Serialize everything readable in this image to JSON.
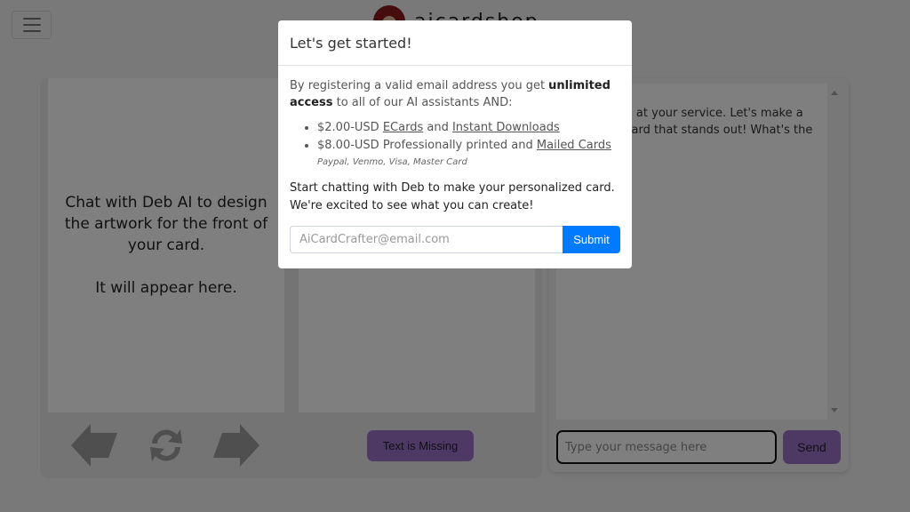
{
  "header": {
    "menu_icon": "hamburger-menu-icon",
    "logo_text": "aicardshop"
  },
  "card": {
    "front_text": "Chat with Deb AI to design the artwork for the front of your card.\n\nIt will appear here.",
    "prev_icon": "arrow-left-icon",
    "refresh_icon": "refresh-icon",
    "next_icon": "arrow-right-icon",
    "text_missing_label": "Text is Missing"
  },
  "chat": {
    "message": "Hey! DebAI at your service. Let's make a greetings card that stands out! What's the occasion?",
    "input_placeholder": "Type your message here",
    "send_label": "Send"
  },
  "modal": {
    "title": "Let's get started!",
    "intro_pre": "By registering a valid email address you get ",
    "intro_bold": "unlimited access",
    "intro_post": " to all of our AI assistants AND:",
    "offers": [
      {
        "price": "$2.00-USD ",
        "link1": "ECards",
        "mid": " and ",
        "link2": "Instant Downloads"
      },
      {
        "price": "$8.00-USD Professionally printed and ",
        "link1": "Mailed Cards"
      }
    ],
    "payments": "Paypal, Venmo, Visa, Master Card",
    "cta_line1": "Start chatting with Deb to make your personalized card.",
    "cta_line2": "We're excited to see what you can create!",
    "email_placeholder": "AiCardCrafter@email.com",
    "submit_label": "Submit"
  },
  "colors": {
    "accent_purple": "#9d72c9",
    "submit_blue": "#007bff"
  }
}
